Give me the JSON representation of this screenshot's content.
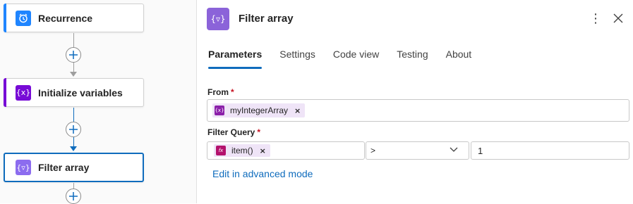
{
  "canvas": {
    "nodes": [
      {
        "label": "Recurrence",
        "icon": "alarm-clock-icon",
        "color": "#1f85ff"
      },
      {
        "label": "Initialize variables",
        "icon": "variable-icon",
        "color": "#770bd6"
      },
      {
        "label": "Filter array",
        "icon": "filter-array-icon",
        "color": "#8c6cef"
      }
    ]
  },
  "panel": {
    "title": "Filter array",
    "tabs": [
      "Parameters",
      "Settings",
      "Code view",
      "Testing",
      "About"
    ],
    "active_tab": "Parameters",
    "from": {
      "label": "From",
      "required_mark": "*",
      "token": "myIntegerArray"
    },
    "filter_query": {
      "label": "Filter Query",
      "required_mark": "*",
      "left_token": "item()",
      "operator": ">",
      "value": "1"
    },
    "advanced_link": "Edit in advanced mode"
  }
}
